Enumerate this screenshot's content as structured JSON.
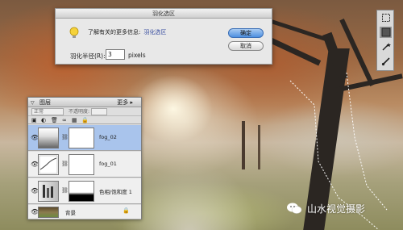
{
  "dialog": {
    "title": "羽化选区",
    "info_text": "了解有关的更多信息:",
    "info_link": "羽化选区",
    "radius_label": "羽化半径(R):",
    "radius_value": "3",
    "radius_unit": "pixels",
    "ok_label": "确定",
    "cancel_label": "取消"
  },
  "toolbar": {
    "tools": [
      "marquee-icon",
      "mask-icon",
      "magic-wand-icon",
      "brush-icon"
    ]
  },
  "layers_panel": {
    "tab_label": "图层",
    "more_label": "更多",
    "blend_mode": "正常",
    "opacity_label": "不透明度:",
    "layers": [
      {
        "name": "fog_02",
        "selected": true,
        "thumb": "gradient",
        "mask": "white"
      },
      {
        "name": "fog_01",
        "selected": false,
        "thumb": "curve",
        "mask": "white"
      },
      {
        "name": "色相/饱和度 1",
        "selected": false,
        "thumb": "adjustment",
        "mask": "black-bottom"
      },
      {
        "name": "背景",
        "selected": false,
        "thumb": "photo",
        "locked": true
      }
    ]
  },
  "watermark": {
    "text": "山水视觉摄影"
  },
  "colors": {
    "selected_row": "#a9c4ec",
    "ok_button": "#4d8fe0",
    "link": "#3a4fa0"
  }
}
